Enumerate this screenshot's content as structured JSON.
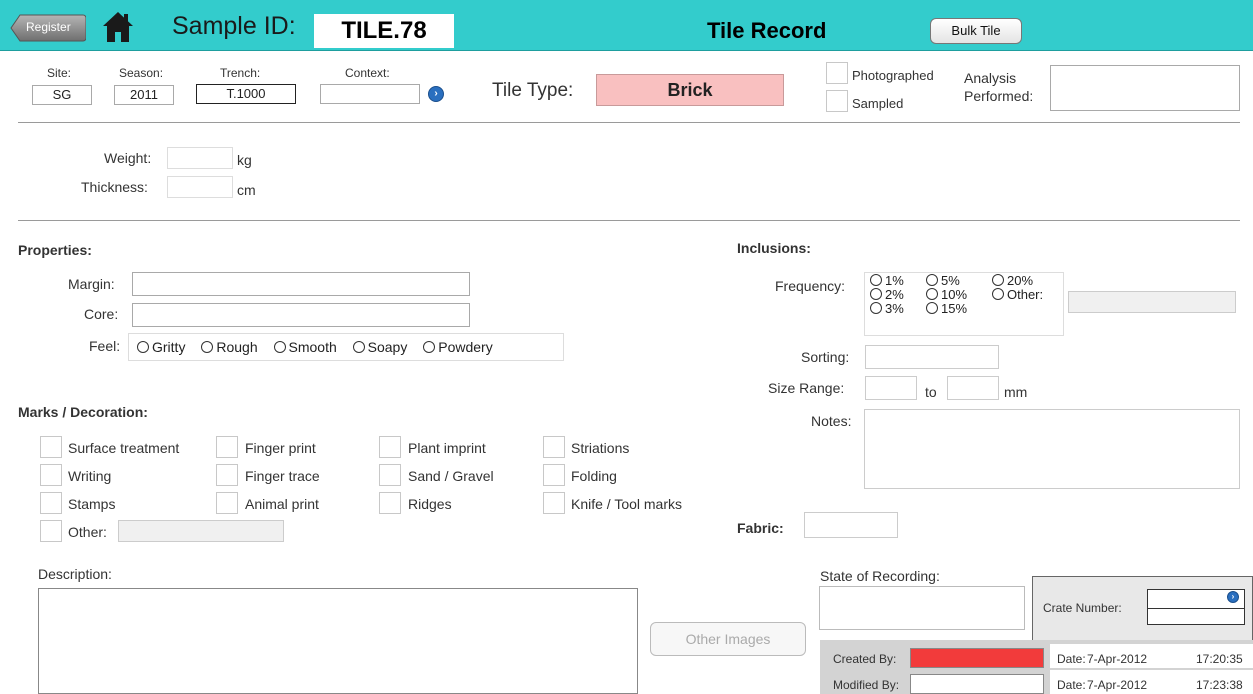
{
  "header": {
    "register_label": "Register",
    "sample_id_label": "Sample ID:",
    "sample_id_value": "TILE.78",
    "record_title": "Tile Record",
    "bulk_tile_label": "Bulk Tile",
    "bg_color": "#33cccc"
  },
  "top": {
    "site_label": "Site:",
    "site_value": "SG",
    "season_label": "Season:",
    "season_value": "2011",
    "trench_label": "Trench:",
    "trench_value": "T.1000",
    "context_label": "Context:",
    "context_value": "",
    "tile_type_label": "Tile Type:",
    "tile_type_value": "Brick",
    "photographed_label": "Photographed",
    "sampled_label": "Sampled",
    "analysis_label_1": "Analysis",
    "analysis_label_2": "Performed:"
  },
  "measure": {
    "weight_label": "Weight:",
    "weight_unit": "kg",
    "thickness_label": "Thickness:",
    "thickness_unit": "cm"
  },
  "properties": {
    "heading": "Properties:",
    "margin_label": "Margin:",
    "core_label": "Core:",
    "feel_label": "Feel:",
    "feel_options": [
      "Gritty",
      "Rough",
      "Smooth",
      "Soapy",
      "Powdery"
    ]
  },
  "marks": {
    "heading": "Marks / Decoration:",
    "col1": [
      "Surface treatment",
      "Writing",
      "Stamps"
    ],
    "col2": [
      "Finger print",
      "Finger trace",
      "Animal print"
    ],
    "col3": [
      "Plant imprint",
      "Sand / Gravel",
      "Ridges"
    ],
    "col4": [
      "Striations",
      "Folding",
      "Knife / Tool marks"
    ],
    "other_label": "Other:"
  },
  "description_label": "Description:",
  "other_images_label": "Other Images",
  "inclusions": {
    "heading": "Inclusions:",
    "frequency_label": "Frequency:",
    "freq_col1": [
      "1%",
      "2%",
      "3%"
    ],
    "freq_col2": [
      "5%",
      "10%",
      "15%"
    ],
    "freq_col3": [
      "20%",
      "Other:"
    ],
    "sorting_label": "Sorting:",
    "size_range_label": "Size Range:",
    "to_label": "to",
    "mm_label": "mm",
    "notes_label": "Notes:"
  },
  "fabric_label": "Fabric:",
  "state_label": "State of Recording:",
  "crate_label": "Crate Number:",
  "created_by_label": "Created By:",
  "modified_by_label": "Modified By:",
  "date_label": "Date:",
  "created_date": "7-Apr-2012",
  "created_time": "17:20:35",
  "modified_date": "7-Apr-2012",
  "modified_time": "17:23:38",
  "colors": {
    "tile_type_bg": "#f9c0c0",
    "created_by_bg": "#f23b3b"
  }
}
